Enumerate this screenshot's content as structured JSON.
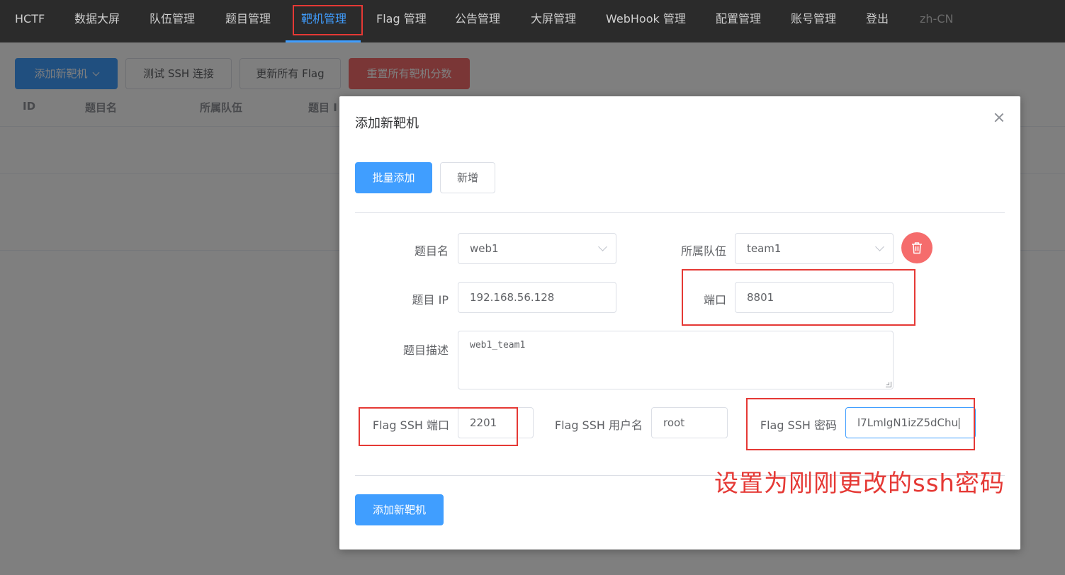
{
  "nav": {
    "items": [
      "HCTF",
      "数据大屏",
      "队伍管理",
      "题目管理",
      "靶机管理",
      "Flag 管理",
      "公告管理",
      "大屏管理",
      "WebHook 管理",
      "配置管理",
      "账号管理",
      "登出"
    ],
    "active": "靶机管理",
    "locale": "zh-CN",
    "active_color": "#409eff"
  },
  "toolbar": {
    "add_label": "添加新靶机",
    "test_ssh_label": "测试 SSH 连接",
    "update_flags_label": "更新所有 Flag",
    "reset_scores_label": "重置所有靶机分数"
  },
  "table": {
    "headers": [
      "ID",
      "题目名",
      "所属队伍",
      "题目 I"
    ]
  },
  "modal": {
    "title": "添加新靶机",
    "tabs": {
      "batch_label": "批量添加",
      "single_label": "新增"
    },
    "fields": {
      "challenge_label": "题目名",
      "challenge_value": "web1",
      "team_label": "所属队伍",
      "team_value": "team1",
      "ip_label": "题目 IP",
      "ip_value": "192.168.56.128",
      "port_label": "端口",
      "port_value": "8801",
      "desc_label": "题目描述",
      "desc_value": "web1_team1",
      "ssh_port_label": "Flag SSH 端口",
      "ssh_port_value": "2201",
      "ssh_user_label": "Flag SSH 用户名",
      "ssh_user_value": "root",
      "ssh_pass_label": "Flag SSH 密码",
      "ssh_pass_value": "l7LmlgN1izZ5dChu"
    },
    "submit_label": "添加新靶机"
  },
  "annotation": {
    "note": "设置为刚刚更改的ssh密码",
    "color": "#e53935"
  },
  "icons": [
    "close-icon",
    "chevron-down-icon",
    "trash-icon"
  ]
}
